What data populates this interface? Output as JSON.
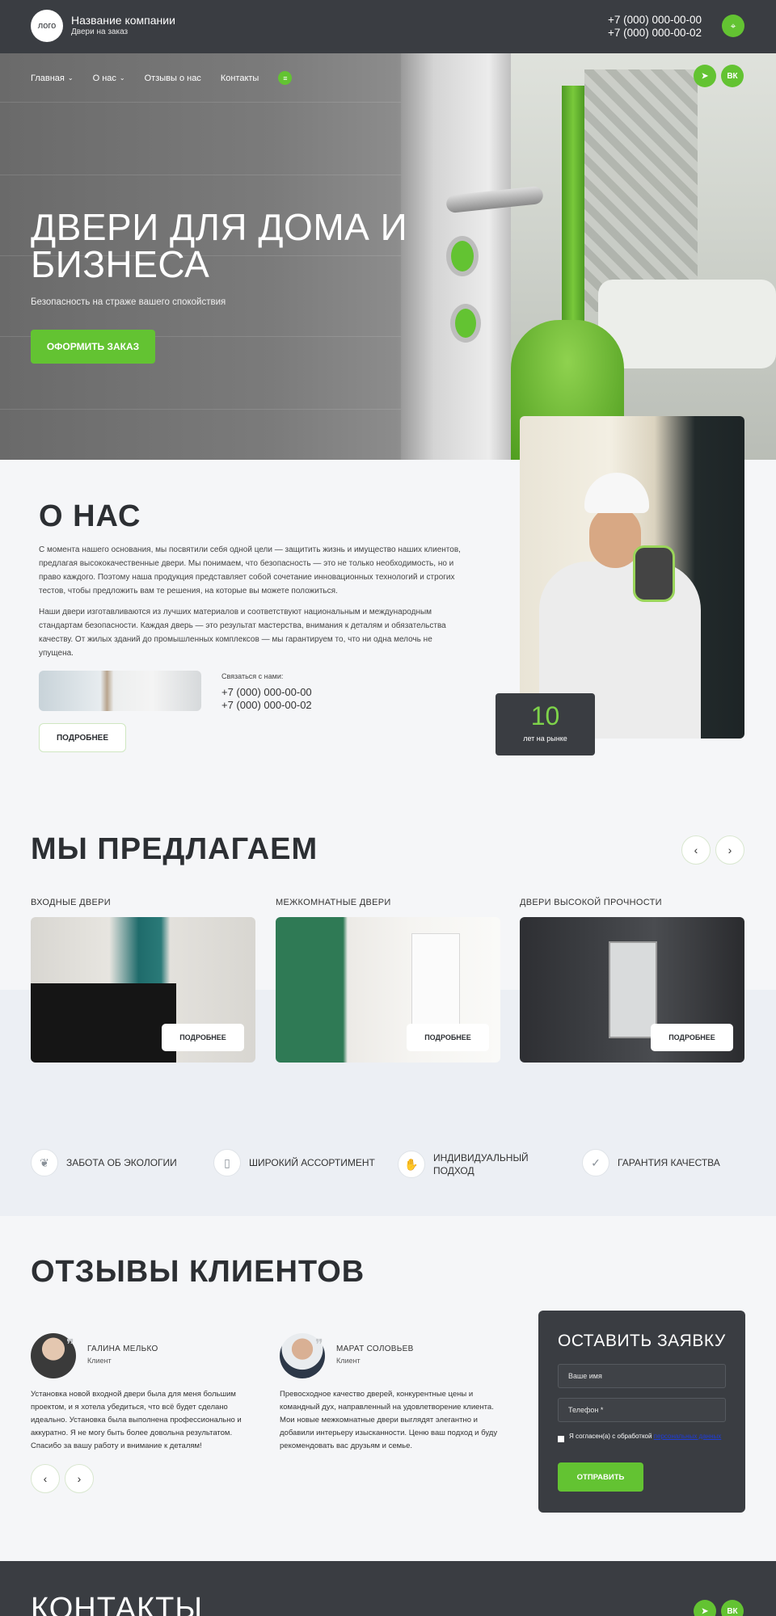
{
  "header": {
    "logo": "лого",
    "company_name": "Название компании",
    "company_sub": "Двери на заказ",
    "phone1": "+7 (000) 000-00-00",
    "phone2": "+7 (000) 000-00-02"
  },
  "nav": {
    "items": [
      "Главная",
      "О нас",
      "Отзывы о нас",
      "Контакты"
    ]
  },
  "hero": {
    "title": "ДВЕРИ ДЛЯ ДОМА И БИЗНЕСА",
    "subtitle": "Безопасность на страже вашего спокойствия",
    "cta": "ОФОРМИТЬ ЗАКАЗ"
  },
  "social": {
    "telegram": "telegram-icon",
    "vk": "ВК"
  },
  "about": {
    "title": "О НАС",
    "p1": "С момента нашего основания, мы посвятили себя одной цели — защитить жизнь и имущество наших клиентов, предлагая высококачественные двери. Мы понимаем, что безопасность — это не только необходимость, но и право каждого. Поэтому наша продукция представляет собой сочетание инновационных технологий и строгих тестов, чтобы предложить вам те решения, на которые вы можете положиться.",
    "p2": "Наши двери изготавливаются из лучших материалов и соответствуют национальным и международным стандартам безопасности. Каждая дверь — это результат мастерства, внимания к деталям и обязательства качеству. От жилых зданий до промышленных комплексов — мы гарантируем то, что ни одна мелочь не упущена.",
    "contact_label": "Связаться с нами:",
    "phone1": "+7 (000) 000-00-00",
    "phone2": "+7 (000) 000-00-02",
    "more": "ПОДРОБНЕЕ",
    "years_num": "10",
    "years_label": "лет на рынке"
  },
  "offer": {
    "title": "МЫ ПРЕДЛАГАЕМ",
    "cards": [
      {
        "label": "ВХОДНЫЕ ДВЕРИ",
        "button": "ПОДРОБНЕЕ"
      },
      {
        "label": "МЕЖКОМНАТНЫЕ ДВЕРИ",
        "button": "ПОДРОБНЕЕ"
      },
      {
        "label": "ДВЕРИ ВЫСОКОЙ ПРОЧНОСТИ",
        "button": "ПОДРОБНЕЕ"
      }
    ]
  },
  "features": [
    {
      "label": "ЗАБОТА ОБ ЭКОЛОГИИ",
      "icon": "leaf-hand-icon"
    },
    {
      "label": "ШИРОКИЙ АССОРТИМЕНТ",
      "icon": "door-icon"
    },
    {
      "label": "ИНДИВИДУАЛЬНЫЙ ПОДХОД",
      "icon": "handshake-icon"
    },
    {
      "label": "ГАРАНТИЯ КАЧЕСТВА",
      "icon": "shield-check-icon"
    }
  ],
  "reviews": {
    "title": "ОТЗЫВЫ КЛИЕНТОВ",
    "items": [
      {
        "name": "ГАЛИНА МЕЛЬКО",
        "role": "Клиент",
        "text": "Установка новой входной двери была для меня большим проектом, и я хотела убедиться, что всё будет сделано идеально. Установка была выполнена профессионально и аккуратно. Я не могу быть более довольна результатом. Спасибо за вашу работу и внимание к деталям!"
      },
      {
        "name": "МАРАТ СОЛОВЬЕВ",
        "role": "Клиент",
        "text": "Превосходное качество дверей, конкурентные цены и командный дух, направленный на удовлетворение клиента. Мои новые межкомнатные двери выглядят элегантно и добавили интерьеру изысканности. Ценю ваш подход и буду рекомендовать вас друзьям и семье."
      }
    ]
  },
  "form": {
    "title": "ОСТАВИТЬ ЗАЯВКУ",
    "name_placeholder": "Ваше имя",
    "phone_placeholder": "Телефон *",
    "consent_text": "Я согласен(а) с обработкой ",
    "consent_link": "персональных данных",
    "submit": "ОТПРАВИТЬ"
  },
  "contacts": {
    "title": "КОНТАКТЫ"
  },
  "colors": {
    "accent": "#63c332",
    "dark": "#3a3d42"
  }
}
